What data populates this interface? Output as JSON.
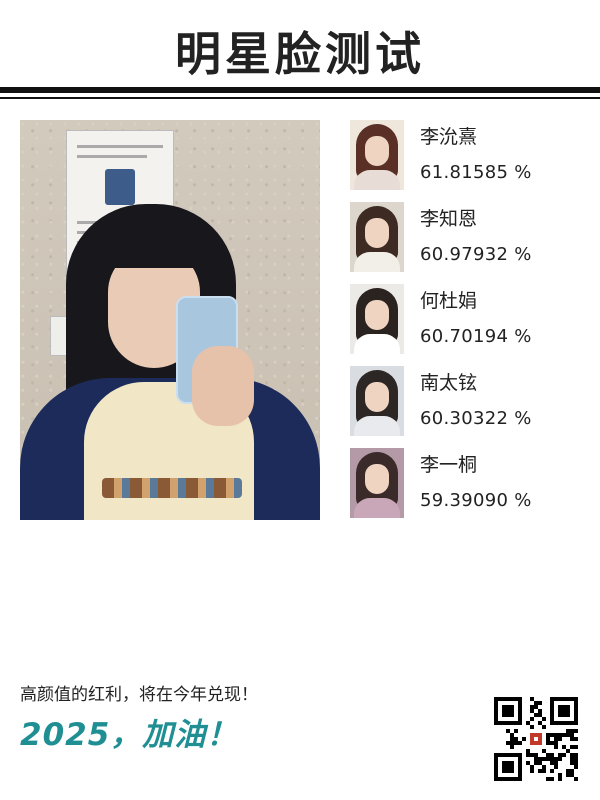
{
  "header": {
    "title": "明星脸测试"
  },
  "matches": [
    {
      "name": "李沇熹",
      "score": "61.81585 %",
      "hair": "#5a3026",
      "bg": "#efe6dc",
      "body": "#e8ddd6"
    },
    {
      "name": "李知恩",
      "score": "60.97932 %",
      "hair": "#3d2a22",
      "bg": "#dcd6cc",
      "body": "#f2efe9"
    },
    {
      "name": "何杜娟",
      "score": "60.70194 %",
      "hair": "#2a2320",
      "bg": "#eceae6",
      "body": "#ffffff"
    },
    {
      "name": "南太铉",
      "score": "60.30322 %",
      "hair": "#2c2624",
      "bg": "#d9dde2",
      "body": "#e9eaee"
    },
    {
      "name": "李一桐",
      "score": "59.39090 %",
      "hair": "#3a2a2a",
      "bg": "#b49aa6",
      "body": "#c9a7b9"
    }
  ],
  "footer": {
    "slogan_line1": "高颜值的红利，将在今年兑现！",
    "slogan_line2": "2025，加油！",
    "accent_color": "#1f8f93"
  }
}
